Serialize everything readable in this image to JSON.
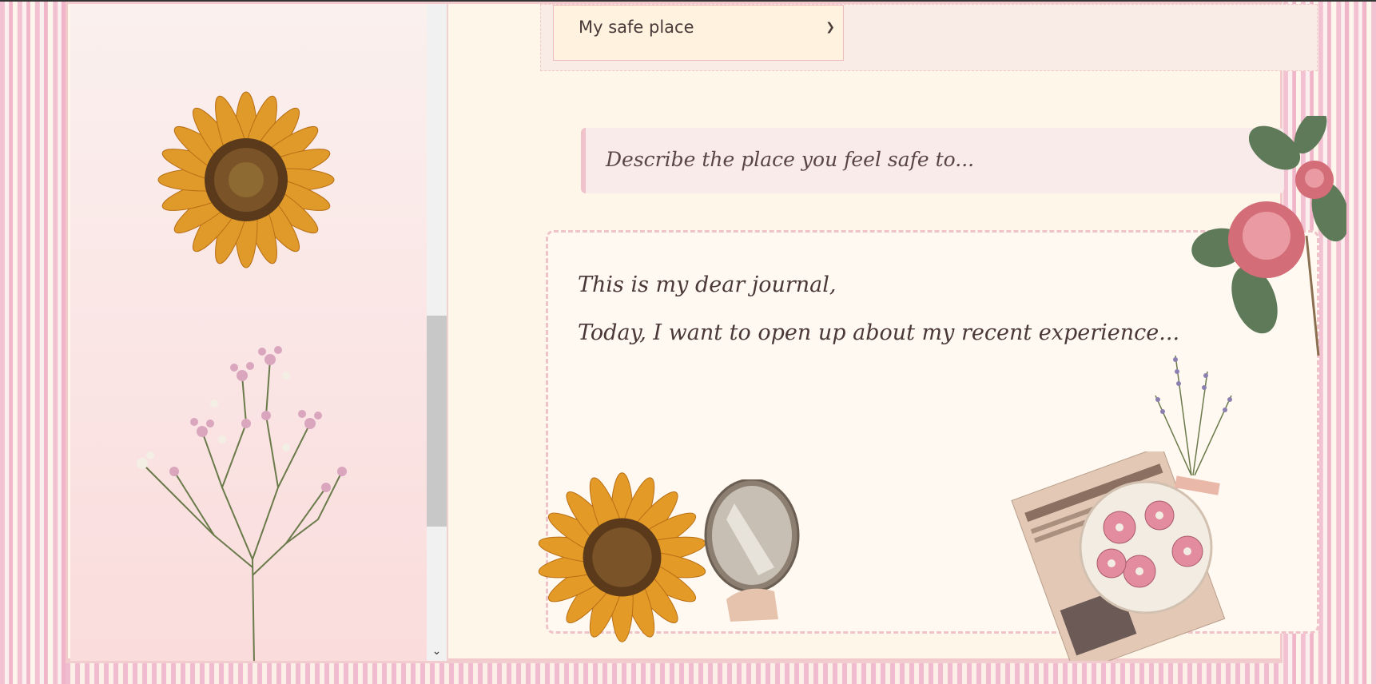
{
  "safe_place_select": {
    "selected": "My safe place"
  },
  "prompt": {
    "text": "Describe the place you feel safe to..."
  },
  "journal": {
    "lines": [
      "This is my dear journal,",
      "Today, I want to open up about my recent experience..."
    ]
  },
  "colors": {
    "accent_pink": "#f0c3cb",
    "cream": "#fef7e9",
    "text": "#4a3838"
  },
  "icons": {
    "select_caret": "chevron-down-icon",
    "scroll_down": "scroll-down-arrow-icon"
  }
}
